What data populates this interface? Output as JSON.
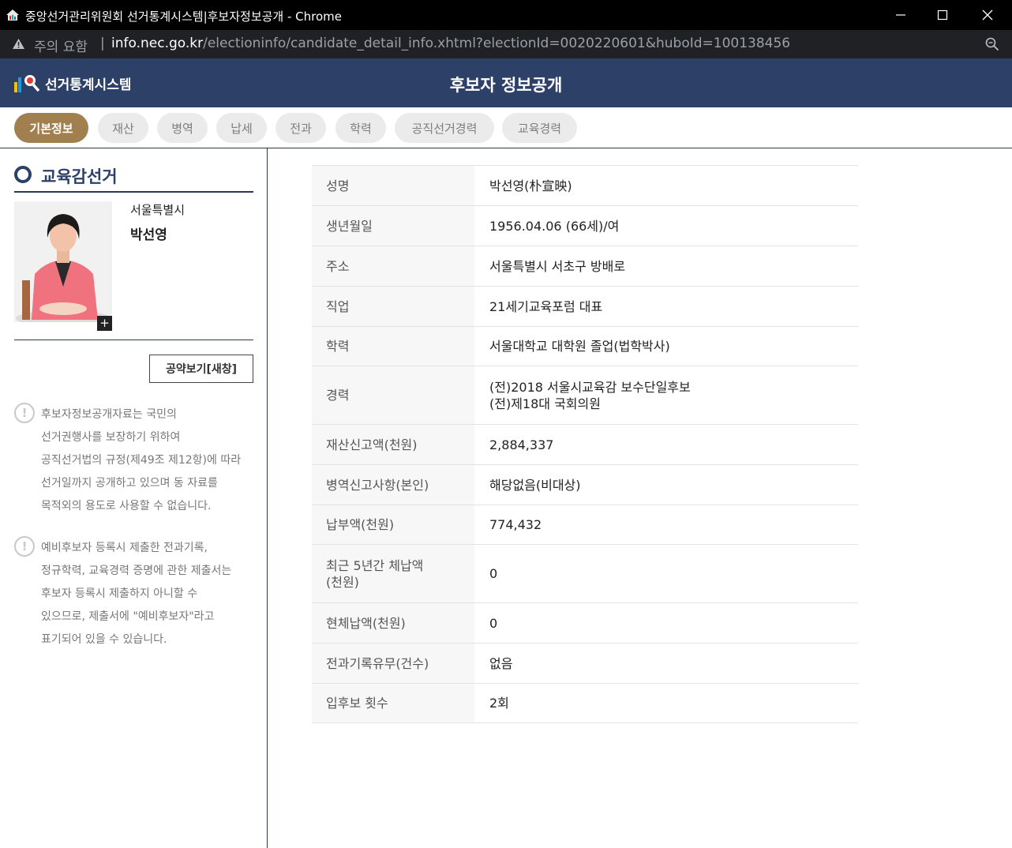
{
  "window": {
    "title": "중앙선거관리위원회 선거통계시스템|후보자정보공개 - Chrome"
  },
  "address": {
    "warning_label": "주의 요함",
    "separator": "|",
    "url_host": "info.nec.go.kr",
    "url_path": "/electioninfo/candidate_detail_info.xhtml?electionId=0020220601&huboId=100138456"
  },
  "header": {
    "logo_text": "선거통계시스템",
    "page_title": "후보자 정보공개"
  },
  "tabs": [
    {
      "label": "기본정보"
    },
    {
      "label": "재산"
    },
    {
      "label": "병역"
    },
    {
      "label": "납세"
    },
    {
      "label": "전과"
    },
    {
      "label": "학력"
    },
    {
      "label": "공직선거경력"
    },
    {
      "label": "교육경력"
    }
  ],
  "sidebar": {
    "section_title": "교육감선거",
    "region": "서울특별시",
    "name": "박선영",
    "photo_plus": "+",
    "pledge_button": "공약보기[새창]",
    "notices": [
      {
        "icon": "!",
        "lines": [
          "후보자정보공개자료는 국민의",
          "선거권행사를 보장하기 위하여",
          "공직선거법의 규정(제49조 제12항)에 따라",
          "선거일까지 공개하고 있으며 동 자료를",
          "목적외의 용도로 사용할 수 없습니다."
        ]
      },
      {
        "icon": "!",
        "lines": [
          "예비후보자 등록시 제출한 전과기록,",
          "정규학력, 교육경력 증명에 관한 제출서는",
          "후보자 등록시 제출하지 아니할 수",
          "있으므로, 제출서에 \"예비후보자\"라고",
          "표기되어 있을 수 있습니다."
        ]
      }
    ]
  },
  "info": {
    "rows": [
      {
        "label": "성명",
        "values": [
          "박선영(朴宣映)"
        ]
      },
      {
        "label": "생년월일",
        "values": [
          "1956.04.06 (66세)/여"
        ]
      },
      {
        "label": "주소",
        "values": [
          "서울특별시 서초구 방배로"
        ]
      },
      {
        "label": "직업",
        "values": [
          "21세기교육포럼 대표"
        ]
      },
      {
        "label": "학력",
        "values": [
          "서울대학교 대학원 졸업(법학박사)"
        ]
      },
      {
        "label": "경력",
        "values": [
          "(전)2018 서울시교육감 보수단일후보",
          "(전)제18대 국회의원"
        ]
      },
      {
        "label": "재산신고액(천원)",
        "values": [
          "2,884,337"
        ]
      },
      {
        "label": "병역신고사항(본인)",
        "values": [
          "해당없음(비대상)"
        ]
      },
      {
        "label": "납부액(천원)",
        "values": [
          "774,432"
        ]
      },
      {
        "label": "최근 5년간 체납액 (천원)",
        "values": [
          "0"
        ]
      },
      {
        "label": "현체납액(천원)",
        "values": [
          "0"
        ]
      },
      {
        "label": "전과기록유무(건수)",
        "values": [
          "없음"
        ]
      },
      {
        "label": "입후보 횟수",
        "values": [
          "2회"
        ]
      }
    ]
  },
  "colors": {
    "header_bg": "#2d4068",
    "tab_active": "#a27f4f",
    "tab_inactive": "#ebebeb"
  }
}
